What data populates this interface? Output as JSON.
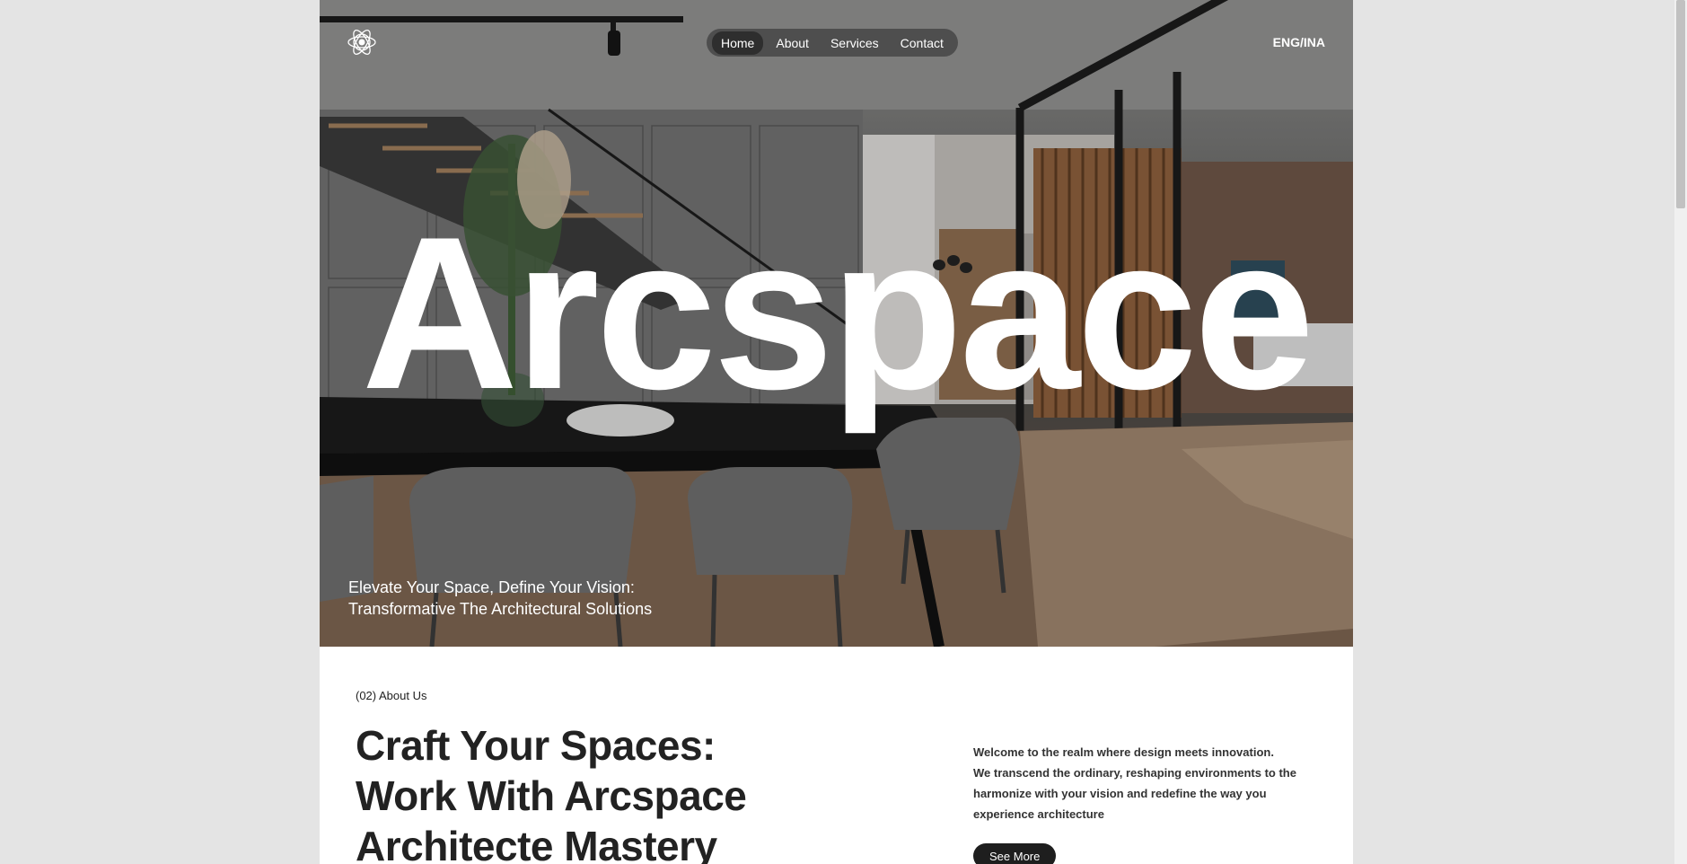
{
  "nav": {
    "items": [
      {
        "label": "Home",
        "active": true
      },
      {
        "label": "About",
        "active": false
      },
      {
        "label": "Services",
        "active": false
      },
      {
        "label": "Contact",
        "active": false
      }
    ],
    "language": "ENG/INA",
    "logo_icon": "atom-logo-icon"
  },
  "hero": {
    "title": "Arcspace",
    "subtitle_line1": "Elevate Your Space, Define Your Vision:",
    "subtitle_line2": "Transformative The Architectural Solutions"
  },
  "about": {
    "tag": "(02) About Us",
    "heading": "Craft Your Spaces: Work With Arcspace Architecte Mastery",
    "text_line1": "Welcome to the realm where design meets innovation.",
    "text_line2": "We transcend the ordinary, reshaping environments to the harmonize with your vision and redefine the way you experience architecture",
    "button_label": "See More"
  },
  "colors": {
    "page_bg": "#e4e4e4",
    "content_bg": "#ffffff",
    "nav_pill": "#464646",
    "button_bg": "#1e1e1e"
  }
}
